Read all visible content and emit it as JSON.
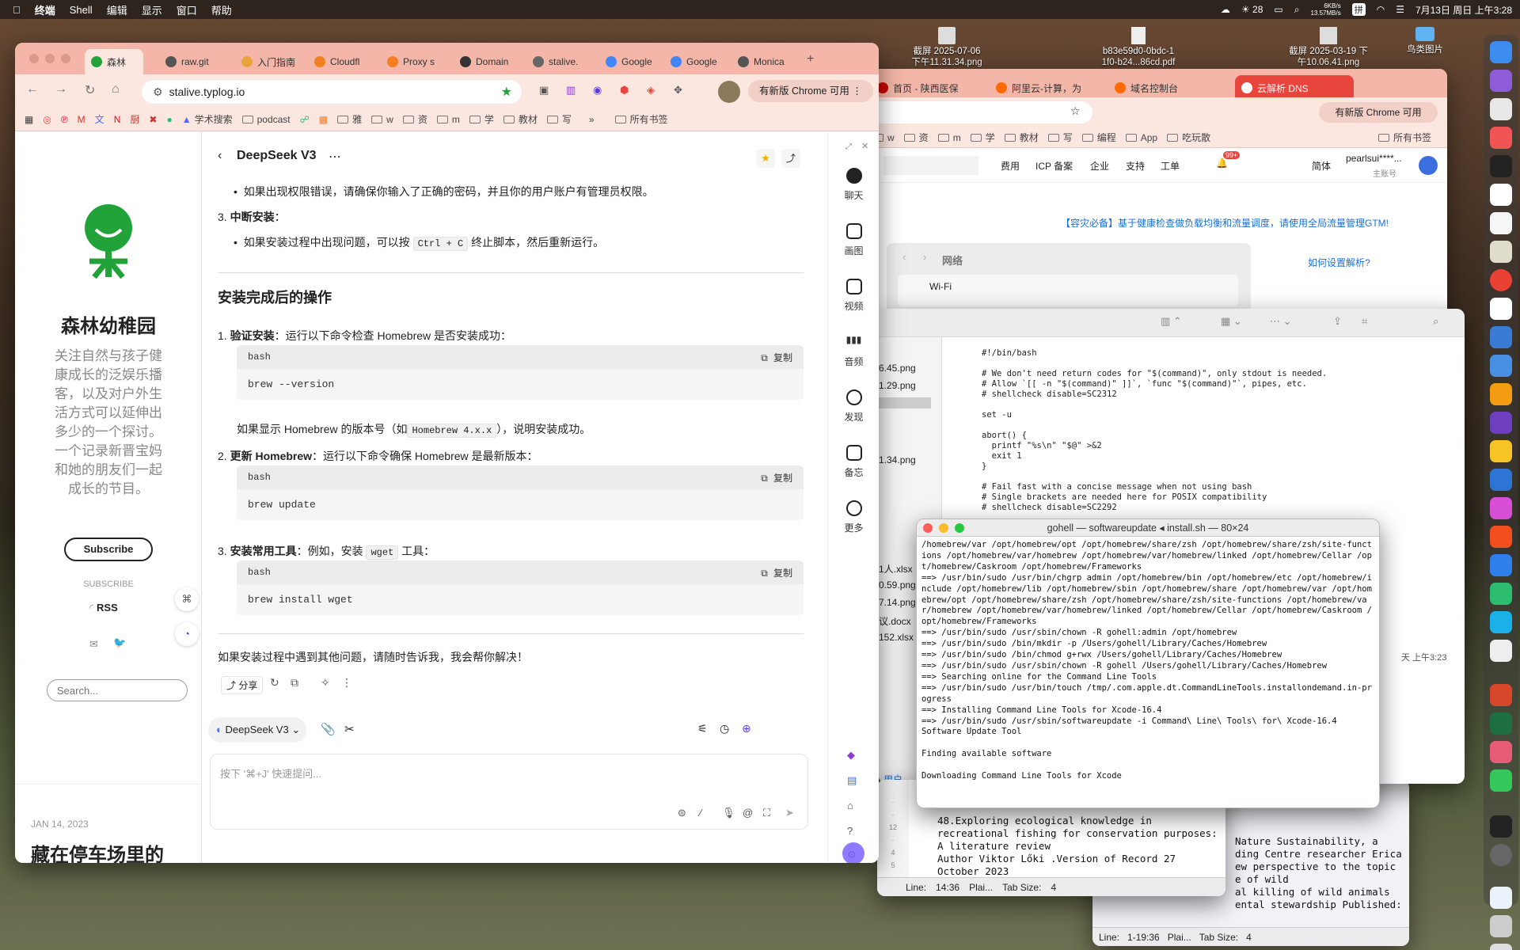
{
  "menubar": {
    "app": "终端",
    "items": [
      "Shell",
      "编辑",
      "显示",
      "窗口",
      "帮助"
    ],
    "temp": "28",
    "net_up": "6KB/s",
    "net_down": "13.57MB/s",
    "input_method": "拼",
    "datetime": "7月13日 周日 上午3:28"
  },
  "desktop": {
    "icons": [
      {
        "label1": "截屏 2025-07-06",
        "label2": "下午11.31.34.png"
      },
      {
        "label1": "b83e59d0-0bdc-1",
        "label2": "1f0-b24...86cd.pdf"
      },
      {
        "label1": "截屏 2025-03-19 下",
        "label2": "午10.06.41.png"
      },
      {
        "label1": "鸟类图片",
        "label2": ""
      }
    ]
  },
  "main_chrome": {
    "tabs": [
      "森林",
      "raw.git",
      "入门指南",
      "Cloudfl",
      "Proxy s",
      "Domain",
      "stalive.",
      "Google",
      "Google",
      "Monica"
    ],
    "url": "stalive.typlog.io",
    "update_btn": "有新版 Chrome 可用",
    "bookmarks": [
      "学术搜索",
      "podcast",
      "雅",
      "w",
      "资",
      "m",
      "学",
      "教材",
      "写"
    ],
    "all_bookmarks": "所有书签"
  },
  "blog": {
    "title": "森林幼稚园",
    "desc": "关注自然与孩子健康成长的泛娱乐播客，以及对户外生活方式可以延伸出多少的一个探讨。一个记录新晋宝妈和她的朋友们一起成长的节目。",
    "subscribe_btn": "Subscribe",
    "subscribe_label": "SUBSCRIBE",
    "rss": "RSS",
    "search_placeholder": "Search...",
    "post_date": "JAN 14, 2023",
    "post_title": "藏在停车场里的"
  },
  "chat": {
    "model_title": "DeepSeek V3",
    "b1": "如果出现权限错误，请确保你输入了正确的密码，并且你的用户账户有管理员权限。",
    "s3_title": "中断安装",
    "s3_colon": "：",
    "b2_pre": "如果安装过程中出现问题，可以按",
    "b2_kbd": "Ctrl + C",
    "b2_post": "终止脚本，然后重新运行。",
    "heading": "安装完成后的操作",
    "item1_title": "验证安装",
    "item1_text": "：运行以下命令检查 Homebrew 是否安装成功：",
    "code_lang": "bash",
    "copy": "复制",
    "code1": "brew --version",
    "item1_note_pre": "如果显示 Homebrew 的版本号（如",
    "item1_note_kbd": "Homebrew 4.x.x",
    "item1_note_post": "），说明安装成功。",
    "item2_title": "更新 Homebrew",
    "item2_text": "：运行以下命令确保 Homebrew 是最新版本：",
    "code2": "brew update",
    "item3_title": "安装常用工具",
    "item3_text_pre": "：例如，安装",
    "item3_kbd": "wget",
    "item3_text_post": "工具：",
    "code3": "brew install wget",
    "closing": "如果安装过程中遇到其他问题，请随时告诉我，我会帮你解决！",
    "share": "分享",
    "model_select": "DeepSeek V3",
    "input_placeholder": "按下 '⌘+J' 快速提问...",
    "nums": [
      "1.",
      "2.",
      "3."
    ]
  },
  "rail": {
    "items": [
      "聊天",
      "画图",
      "视频",
      "音频",
      "发现",
      "备忘",
      "更多"
    ]
  },
  "right_chrome": {
    "tabs": [
      "首页 - 陕西医保",
      "阿里云-计算，为",
      "域名控制台",
      "云解析 DNS"
    ],
    "update_btn": "有新版 Chrome 可用",
    "bookmarks": [
      "w",
      "资",
      "m",
      "学",
      "教材",
      "写",
      "编程",
      "App",
      "吃玩散"
    ],
    "all_bookmarks": "所有书签",
    "nav": [
      "费用",
      "ICP 备案",
      "企业",
      "支持",
      "工单",
      "简体"
    ],
    "badge": "99+",
    "user": "pearlsui****...",
    "user_sub": "主账号",
    "banner": "【容灾必备】基于健康检查做负载均衡和流量调度，请使用全局流量管理GTM!",
    "howto": "如何设置解析?",
    "settings_title": "网络",
    "wifi": "Wi-Fi"
  },
  "script": {
    "files": [
      "6.45.png",
      "1.29.png",
      "1.34.png",
      "1人.xlsx",
      "0.59.png",
      "7.14.png",
      "议.docx",
      "152.xlsx",
      "用户"
    ],
    "code": "#!/bin/bash\n\n# We don't need return codes for \"$(command)\", only stdout is needed.\n# Allow `[[ -n \"$(command)\" ]]`, `func \"$(command)\"`, pipes, etc.\n# shellcheck disable=SC2312\n\nset -u\n\nabort() {\n  printf \"%s\\n\" \"$@\" >&2\n  exit 1\n}\n\n# Fail fast with a concise message when not using bash\n# Single brackets are needed here for POSIX compatibility\n# shellcheck disable=SC2292",
    "date": "天 上午3:23"
  },
  "terminal": {
    "title": "gohell — softwareupdate ◂ install.sh — 80×24",
    "text": "/homebrew/var /opt/homebrew/opt /opt/homebrew/share/zsh /opt/homebrew/share/zsh/site-functions /opt/homebrew/var/homebrew /opt/homebrew/var/homebrew/linked /opt/homebrew/Cellar /opt/homebrew/Caskroom /opt/homebrew/Frameworks\n==> /usr/bin/sudo /usr/bin/chgrp admin /opt/homebrew/bin /opt/homebrew/etc /opt/homebrew/include /opt/homebrew/lib /opt/homebrew/sbin /opt/homebrew/share /opt/homebrew/var /opt/homebrew/opt /opt/homebrew/share/zsh /opt/homebrew/share/zsh/site-functions /opt/homebrew/var/homebrew /opt/homebrew/var/homebrew/linked /opt/homebrew/Cellar /opt/homebrew/Caskroom /opt/homebrew/Frameworks\n==> /usr/bin/sudo /usr/sbin/chown -R gohell:admin /opt/homebrew\n==> /usr/bin/sudo /bin/mkdir -p /Users/gohell/Library/Caches/Homebrew\n==> /usr/bin/sudo /bin/chmod g+rwx /Users/gohell/Library/Caches/Homebrew\n==> /usr/bin/sudo /usr/sbin/chown -R gohell /Users/gohell/Library/Caches/Homebrew\n==> Searching online for the Command Line Tools\n==> /usr/bin/sudo /usr/bin/touch /tmp/.com.apple.dt.CommandLineTools.installondemand.in-progress\n==> Installing Command Line Tools for Xcode-16.4\n==> /usr/bin/sudo /usr/sbin/softwareupdate -i Command\\ Line\\ Tools\\ for\\ Xcode-16.4\nSoftware Update Tool\n\nFinding available software\n\nDownloading Command Line Tools for Xcode"
  },
  "textedit": {
    "text": "48.Exploring ecological knowledge in\nrecreational fishing for conservation purposes:\nA literature review\nAuthor Viktor Lőki .Version of Record 27\nOctober 2023",
    "status_line": "Line:",
    "status_pos": "14:36",
    "status_plain": "Plai...",
    "status_tab": "Tab Size:",
    "status_tabv": "4"
  },
  "textedit2": {
    "text": "Nature Sustainability, a\nding Centre researcher Erica\new perspective to the topic\ne of wild\nal killing of wild animals\nental stewardship Published:",
    "status_line": "Line:",
    "status_pos": "1-19:36",
    "status_plain": "Plai...",
    "status_tab": "Tab Size:",
    "status_tabv": "4"
  },
  "colors": {
    "tab_bar": "#f4b6a8",
    "toolbar": "#fbe6e0",
    "accent_red": "#e8453c",
    "link_blue": "#1a6fd6",
    "logo_green": "#22a33a",
    "aliyun_orange": "#ff6a00"
  }
}
